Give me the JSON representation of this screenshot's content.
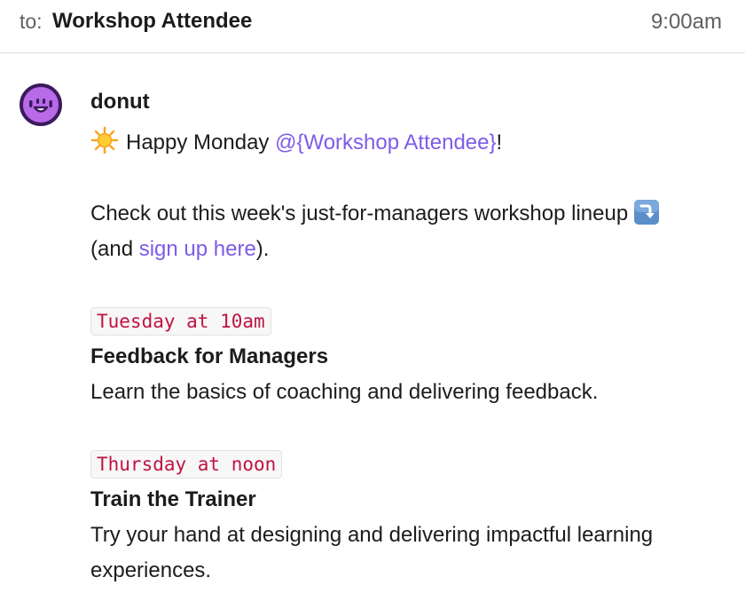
{
  "header": {
    "to_label": "to:",
    "recipient": "Workshop Attendee",
    "time": "9:00am"
  },
  "message": {
    "sender": "donut",
    "greeting_prefix": "Happy Monday ",
    "greeting_mention": "@{Workshop Attendee}",
    "greeting_suffix": "!",
    "intro_line1": "Check out this week's just-for-managers workshop lineup",
    "intro_line2_prefix": "(and ",
    "signup_link": "sign up here",
    "intro_line2_suffix": ").",
    "sessions": [
      {
        "when": "Tuesday at 10am",
        "title": "Feedback for Managers",
        "description_lines": [
          "Learn the basics of coaching and delivering feedback."
        ]
      },
      {
        "when": "Thursday at noon",
        "title": "Train the Trainer",
        "description_lines": [
          "Try your hand at designing and delivering impactful learning",
          "experiences."
        ]
      }
    ]
  },
  "colors": {
    "accent": "#7c5ce8",
    "code_text": "#c01343",
    "avatar_ring": "#3a1b5c",
    "avatar_face": "#b96ae8"
  },
  "icons": {
    "avatar": "donut-avatar-icon",
    "sun": "sun-emoji-icon",
    "arrow": "arrow-down-emoji-icon"
  }
}
